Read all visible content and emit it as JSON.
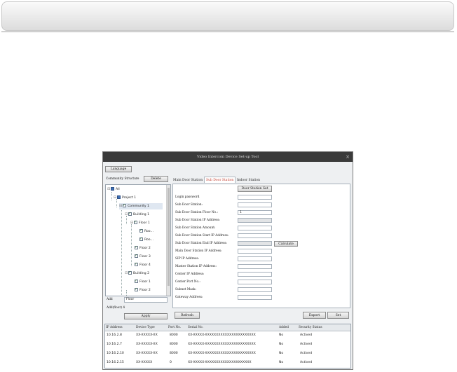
{
  "window": {
    "title": "Video Intercom Device Set-up Tool",
    "close_glyph": "×"
  },
  "toolbar": {
    "language_label": "Language"
  },
  "left": {
    "community_structure_label": "Community Structure",
    "delete_label": "Delete",
    "tree": [
      {
        "label": "All",
        "expander": "⊟",
        "check": "blue"
      },
      {
        "label": "Project 1",
        "expander": "⊟",
        "check": "blue"
      },
      {
        "label": "Community 1",
        "expander": "⊟",
        "check": "checked"
      },
      {
        "label": "Building 1",
        "expander": "⊟",
        "check": "checked"
      },
      {
        "label": "Floor 1",
        "expander": "⊟",
        "check": "checked"
      },
      {
        "label": "Roo...",
        "expander": "",
        "check": "checked"
      },
      {
        "label": "Roo...",
        "expander": "",
        "check": "checked"
      },
      {
        "label": "Floor 2",
        "expander": "",
        "check": "checked"
      },
      {
        "label": "Floor 3",
        "expander": "",
        "check": "checked"
      },
      {
        "label": "Floor 4",
        "expander": "",
        "check": "checked"
      },
      {
        "label": "Building 2",
        "expander": "⊟",
        "check": "checked"
      },
      {
        "label": "Floor 1",
        "expander": "",
        "check": "checked"
      },
      {
        "label": "Floor 2",
        "expander": "",
        "check": "checked"
      }
    ],
    "add_label": "Add",
    "add_select_value": "Floor",
    "add_count_label": "Add(floor) 4",
    "apply_label": "Apply"
  },
  "tabs": [
    "Main Door Station",
    "Sub Door Station",
    "Indoor Station"
  ],
  "form": {
    "set_button": "Door Station Set",
    "rows": [
      {
        "label": "Login password",
        "value": "",
        "disabled": false
      },
      {
        "label": "Sub Door Station:",
        "value": "",
        "disabled": false
      },
      {
        "label": "Sub Door Station Floor No.:",
        "value": "1",
        "disabled": false
      },
      {
        "label": "Sub Door Station IP Address:",
        "value": "",
        "disabled": true
      },
      {
        "label": "Sub Door Station Amount:",
        "value": "",
        "disabled": false
      },
      {
        "label": "Sub Door Station Start IP Address:",
        "value": "",
        "disabled": false
      },
      {
        "label": "Sub Door Station End IP Address:",
        "value": "",
        "disabled": true
      },
      {
        "label": "Main Door Station IP Address:",
        "value": "",
        "disabled": false
      },
      {
        "label": "SIP IP Address:",
        "value": "",
        "disabled": false
      },
      {
        "label": "Master Station IP Address:",
        "value": "",
        "disabled": false
      },
      {
        "label": "Center IP Address:",
        "value": "",
        "disabled": false
      },
      {
        "label": "Center Port No.:",
        "value": "",
        "disabled": false
      },
      {
        "label": "Subnet Mask:",
        "value": "",
        "disabled": false
      },
      {
        "label": "Gateway Address:",
        "value": "",
        "disabled": false
      }
    ],
    "calculate_label": "Calculate"
  },
  "actions": {
    "refresh": "Refresh",
    "export": "Export",
    "set": "Set"
  },
  "table": {
    "headers": [
      "IP Address",
      "Device Type",
      "Port No.",
      "Serial No.",
      "Added",
      "Security Status"
    ],
    "rows": [
      [
        "10.16.2.8",
        "XX-XXXXX-XX",
        "8000",
        "XX-XXXXX-XXXXXXXXXXXXXXXXXXXXXXX",
        "No",
        "Actived"
      ],
      [
        "10.16.2.7",
        "XX-XXXXX-XX",
        "8000",
        "XX-XXXXX-XXXXXXXXXXXXXXXXXXXXXXX",
        "No",
        "Actived"
      ],
      [
        "10.16.2.10",
        "XX-XXXXX-XX",
        "8000",
        "XX-XXXXX-XXXXXXXXXXXXXXXXXXXXXXX",
        "No",
        "Actived"
      ],
      [
        "10.16.2.15",
        "XX-XXXXX",
        "0",
        "XX-XXXXX-XXXXXXXXXXXXXXXXXXXXX",
        "No",
        "Actived"
      ]
    ]
  }
}
